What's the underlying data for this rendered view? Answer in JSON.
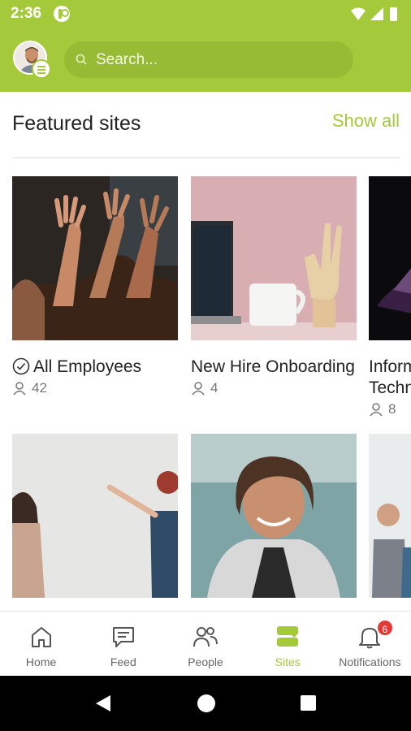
{
  "status": {
    "time": "2:36"
  },
  "search": {
    "placeholder": "Search..."
  },
  "section": {
    "title": "Featured sites",
    "show_all": "Show all"
  },
  "sites": [
    {
      "name": "All Employees",
      "members": "42",
      "followed": true
    },
    {
      "name": "New Hire Onboarding",
      "members": "4",
      "followed": false
    },
    {
      "name": "Information Technology",
      "members": "8",
      "followed": false
    }
  ],
  "nav": {
    "items": [
      {
        "label": "Home",
        "icon": "home-icon"
      },
      {
        "label": "Feed",
        "icon": "chat-icon"
      },
      {
        "label": "People",
        "icon": "people-icon"
      },
      {
        "label": "Sites",
        "icon": "sites-icon",
        "active": true
      },
      {
        "label": "Notifications",
        "icon": "bell-icon",
        "badge": "6"
      }
    ]
  },
  "colors": {
    "brand": "#a4c93a",
    "badge": "#e53935"
  }
}
